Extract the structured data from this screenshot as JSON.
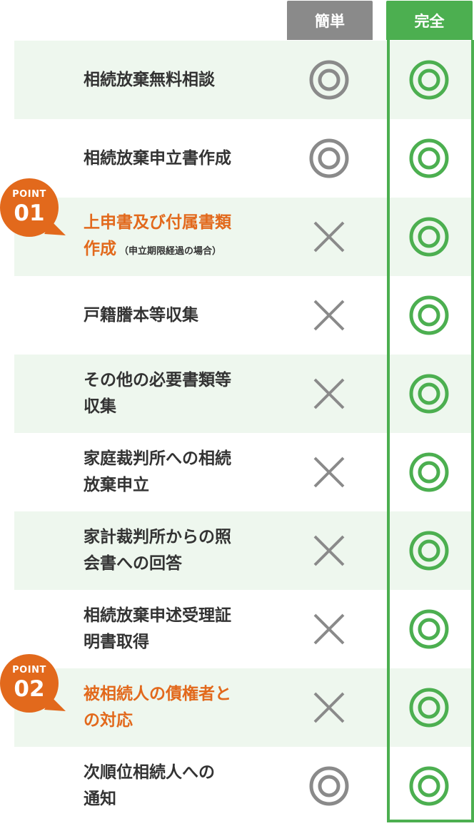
{
  "header": {
    "simple": "簡単",
    "full": "完全"
  },
  "colors": {
    "green": "#4caf50",
    "gray": "#8a8a8a",
    "accent": "#e2691c",
    "row_alt": "#eef7ee"
  },
  "badges": [
    {
      "label": "POINT",
      "number": "01"
    },
    {
      "label": "POINT",
      "number": "02"
    }
  ],
  "rows": [
    {
      "label": "相続放棄無料相談",
      "simple": "double-circle-icon",
      "full": "double-circle-icon"
    },
    {
      "label": "相続放棄申立書作成",
      "simple": "double-circle-icon",
      "full": "double-circle-icon"
    },
    {
      "label_line1": "上申書及び付属書類",
      "label_line2": "作成",
      "note": "（申立期限経過の場合）",
      "simple": "cross-icon",
      "full": "double-circle-icon"
    },
    {
      "label": "戸籍謄本等収集",
      "simple": "cross-icon",
      "full": "double-circle-icon"
    },
    {
      "label_line1": "その他の必要書類等",
      "label_line2": "収集",
      "simple": "cross-icon",
      "full": "double-circle-icon"
    },
    {
      "label_line1": "家庭裁判所への相続",
      "label_line2": "放棄申立",
      "simple": "cross-icon",
      "full": "double-circle-icon"
    },
    {
      "label_line1": "家計裁判所からの照",
      "label_line2": "会書への回答",
      "simple": "cross-icon",
      "full": "double-circle-icon"
    },
    {
      "label_line1": "相続放棄申述受理証",
      "label_line2": "明書取得",
      "simple": "cross-icon",
      "full": "double-circle-icon"
    },
    {
      "label_line1": "被相続人の債権者と",
      "label_line2": "の対応",
      "simple": "cross-icon",
      "full": "double-circle-icon"
    },
    {
      "label_line1": "次順位相続人への",
      "label_line2": "通知",
      "simple": "double-circle-icon",
      "full": "double-circle-icon"
    }
  ]
}
